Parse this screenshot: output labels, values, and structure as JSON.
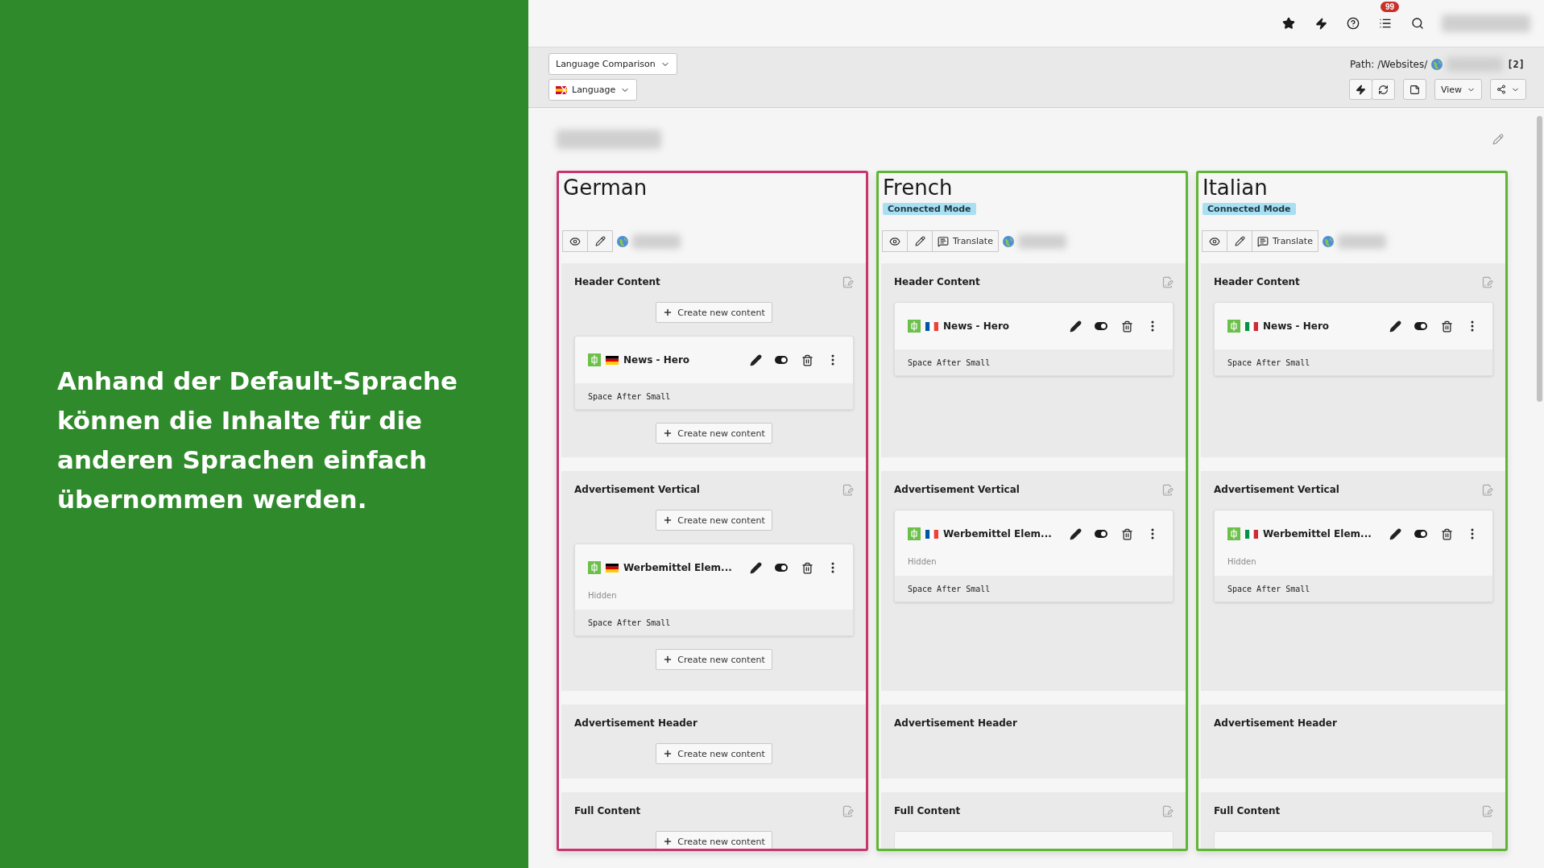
{
  "intro": {
    "text": "Anhand der Default-Sprache\nkönnen die Inhalte für die\nanderen Sprachen einfach\nübernommen werden."
  },
  "topbar": {
    "notification_count": "99"
  },
  "docheader": {
    "view_select": "Language Comparison",
    "language_select": "Language",
    "path_label": "Path: /Websites/",
    "path_suffix": "[2]",
    "view_button": "View"
  },
  "columns": [
    {
      "name": "German",
      "is_default": true,
      "flag": {
        "kind": "horizontal",
        "stripes": [
          {
            "color": "#000000"
          },
          {
            "color": "#dd0000"
          },
          {
            "color": "#ffce00"
          }
        ]
      },
      "buttons": [
        {
          "kind": "view"
        },
        {
          "kind": "edit"
        }
      ],
      "sections": [
        {
          "title": "Header Content",
          "edit_icon": true,
          "items": [
            {
              "kind": "create",
              "label": "Create new content"
            },
            {
              "kind": "element",
              "title": "News - Hero",
              "footer": "Space After Small"
            },
            {
              "kind": "create",
              "label": "Create new content"
            }
          ]
        },
        {
          "title": "Advertisement Vertical",
          "edit_icon": true,
          "items": [
            {
              "kind": "create",
              "label": "Create new content"
            },
            {
              "kind": "element",
              "title": "Werbemittel Elem...",
              "note": "Hidden",
              "footer": "Space After Small"
            },
            {
              "kind": "create",
              "label": "Create new content"
            }
          ]
        },
        {
          "title": "Advertisement Header",
          "edit_icon": false,
          "items": [
            {
              "kind": "create",
              "label": "Create new content"
            }
          ]
        },
        {
          "title": "Full Content",
          "edit_icon": true,
          "items": [
            {
              "kind": "create",
              "label": "Create new content"
            }
          ]
        }
      ]
    },
    {
      "name": "French",
      "is_default": false,
      "badge": "Connected Mode",
      "flag": {
        "kind": "vertical",
        "stripes": [
          {
            "color": "#0055a4"
          },
          {
            "color": "#ffffff"
          },
          {
            "color": "#ef4135"
          }
        ]
      },
      "buttons": [
        {
          "kind": "view"
        },
        {
          "kind": "edit"
        },
        {
          "kind": "translate",
          "label": "Translate"
        }
      ],
      "sections": [
        {
          "title": "Header Content",
          "edit_icon": true,
          "items": [
            {
              "kind": "element",
              "title": "News - Hero",
              "footer": "Space After Small"
            }
          ]
        },
        {
          "title": "Advertisement Vertical",
          "edit_icon": true,
          "items": [
            {
              "kind": "element",
              "title": "Werbemittel Elem...",
              "note": "Hidden",
              "footer": "Space After Small"
            }
          ]
        },
        {
          "title": "Advertisement Header",
          "edit_icon": false
        },
        {
          "title": "Full Content",
          "edit_icon": true,
          "items": [
            {
              "kind": "partial"
            }
          ]
        }
      ]
    },
    {
      "name": "Italian",
      "is_default": false,
      "badge": "Connected Mode",
      "flag": {
        "kind": "vertical",
        "stripes": [
          {
            "color": "#009246"
          },
          {
            "color": "#ffffff"
          },
          {
            "color": "#ce2b37"
          }
        ]
      },
      "buttons": [
        {
          "kind": "view"
        },
        {
          "kind": "edit"
        },
        {
          "kind": "translate",
          "label": "Translate"
        }
      ],
      "sections": [
        {
          "title": "Header Content",
          "edit_icon": true,
          "items": [
            {
              "kind": "element",
              "title": "News - Hero",
              "footer": "Space After Small"
            }
          ]
        },
        {
          "title": "Advertisement Vertical",
          "edit_icon": true,
          "items": [
            {
              "kind": "element",
              "title": "Werbemittel Elem...",
              "note": "Hidden",
              "footer": "Space After Small"
            }
          ]
        },
        {
          "title": "Advertisement Header",
          "edit_icon": false
        },
        {
          "title": "Full Content",
          "edit_icon": true,
          "items": [
            {
              "kind": "partial"
            }
          ]
        }
      ]
    }
  ]
}
